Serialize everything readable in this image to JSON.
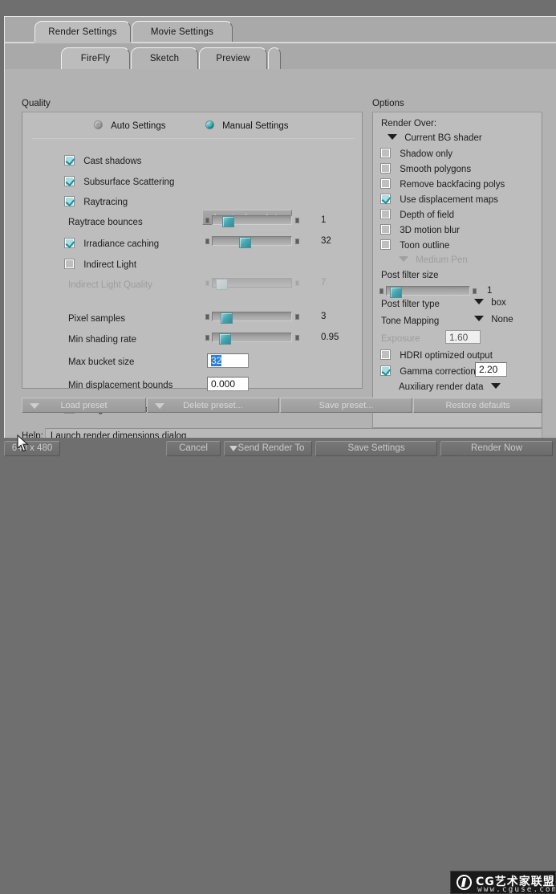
{
  "window": {
    "outer_tabs": [
      {
        "label": "Render Settings",
        "active": true
      },
      {
        "label": "Movie Settings",
        "active": false
      }
    ],
    "inner_tabs": [
      {
        "label": "FireFly",
        "active": true
      },
      {
        "label": "Sketch",
        "active": false
      },
      {
        "label": "Preview",
        "active": false
      }
    ]
  },
  "quality": {
    "title": "Quality",
    "mode": {
      "auto_label": "Auto Settings",
      "auto_selected": false,
      "manual_label": "Manual Settings",
      "manual_selected": true
    },
    "acquire_button": "Acquire from Auto",
    "checkboxes": [
      {
        "label": "Cast shadows",
        "checked": true,
        "enabled": true
      },
      {
        "label": "Subsurface Scattering",
        "checked": true,
        "enabled": true
      },
      {
        "label": "Raytracing",
        "checked": true,
        "enabled": true
      }
    ],
    "raytrace_bounces": {
      "label": "Raytrace bounces",
      "value": "1",
      "slider_pct": 14,
      "enabled": true
    },
    "irradiance_caching": {
      "label": "Irradiance caching",
      "checked": true,
      "enabled": true,
      "value": "32",
      "slider_pct": 36,
      "has_slider": true
    },
    "indirect_light": {
      "label": "Indirect Light",
      "checked": false,
      "enabled": true
    },
    "indirect_light_quality": {
      "label": "Indirect Light Quality",
      "value": "7",
      "slider_pct": 6,
      "enabled": false
    },
    "pixel_samples": {
      "label": "Pixel samples",
      "value": "3",
      "slider_pct": 12,
      "enabled": true
    },
    "min_shading_rate": {
      "label": "Min shading rate",
      "value": "0.95",
      "slider_pct": 10,
      "enabled": true
    },
    "max_bucket_size": {
      "label": "Max bucket size",
      "value": "32",
      "selected": true
    },
    "min_displacement_bounds": {
      "label": "Min displacement bounds",
      "value": "0.000",
      "selected": false
    },
    "progressive_mode": {
      "label": "Progressive Mode",
      "checked": false
    }
  },
  "options": {
    "title": "Options",
    "render_over_label": "Render Over:",
    "render_over_value": "Current BG shader",
    "checkboxes": [
      {
        "label": "Shadow only",
        "checked": false,
        "enabled": true
      },
      {
        "label": "Smooth polygons",
        "checked": false,
        "enabled": true
      },
      {
        "label": "Remove backfacing polys",
        "checked": false,
        "enabled": true
      },
      {
        "label": "Use displacement maps",
        "checked": true,
        "enabled": true
      },
      {
        "label": "Depth of field",
        "checked": false,
        "enabled": true
      },
      {
        "label": "3D motion blur",
        "checked": false,
        "enabled": true
      },
      {
        "label": "Toon outline",
        "checked": false,
        "enabled": true
      }
    ],
    "toon_pen": {
      "label": "Medium Pen",
      "enabled": false
    },
    "post_filter_size": {
      "label": "Post filter size",
      "value": "1",
      "slider_pct": 5,
      "enabled": true
    },
    "post_filter_type": {
      "label": "Post filter type",
      "value": "box"
    },
    "tone_mapping": {
      "label": "Tone Mapping",
      "value": "None"
    },
    "exposure": {
      "label": "Exposure",
      "value": "1.60",
      "enabled": false
    },
    "hdri_optimized": {
      "label": "HDRI optimized output",
      "checked": false
    },
    "gamma_correction": {
      "label": "Gamma correction",
      "checked": true,
      "value": "2.20"
    },
    "auxiliary_render_data": {
      "label": "Auxiliary render data"
    }
  },
  "presets": {
    "load": "Load preset",
    "delete": "Delete preset...",
    "save": "Save preset...",
    "restore": "Restore defaults"
  },
  "help": {
    "label": "Help:",
    "text": "Launch render dimensions dialog"
  },
  "bottom_bar": {
    "dimensions": "640 x 480",
    "cancel": "Cancel",
    "send_render_to": "Send Render To",
    "save_settings": "Save Settings",
    "render_now": "Render Now"
  },
  "watermark": {
    "cn_text": "CG艺术家联盟",
    "url": "www.cguse.com"
  },
  "colors": {
    "accent_teal": "#2b8d98",
    "panel": "#bdbdbd",
    "window": "#b2b2b2",
    "selection_blue": "#2d7fd0",
    "disabled_text": "#9d9d9d"
  }
}
